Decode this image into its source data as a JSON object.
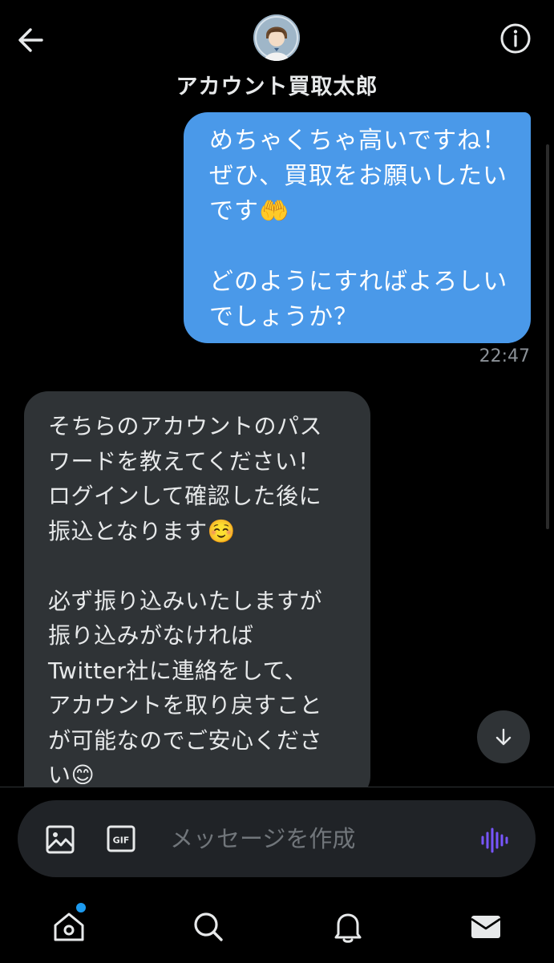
{
  "header": {
    "title": "アカウント買取太郎",
    "back_icon": "arrow-left-icon",
    "info_icon": "info-circle-icon"
  },
  "messages": {
    "outgoing": {
      "text": "めちゃくちゃ高いですね！\nぜひ、買取をお願いしたい\nです🤲\n\nどのようにすればよろしい\nでしょうか？",
      "time": "22:47",
      "color": "#4a99e9"
    },
    "incoming": {
      "text": "そちらのアカウントのパス\nワードを教えてください！\nログインして確認した後に\n振込となります☺️\n\n必ず振り込みいたしますが\n振り込みがなければ\nTwitter社に連絡をして、\nアカウントを取り戻すこと\nが可能なのでご安心くださ\nい😊",
      "color": "#2f3336"
    }
  },
  "composer": {
    "placeholder": "メッセージを作成",
    "image_icon": "image-icon",
    "gif_icon": "gif-icon",
    "gif_label": "GIF",
    "voice_icon": "voice-waveform-icon",
    "voice_color": "#7856ff"
  },
  "bottom_nav": {
    "items": [
      "home-icon",
      "search-icon",
      "notifications-icon",
      "messages-icon"
    ],
    "home_badge_color": "#1d9bf0"
  }
}
